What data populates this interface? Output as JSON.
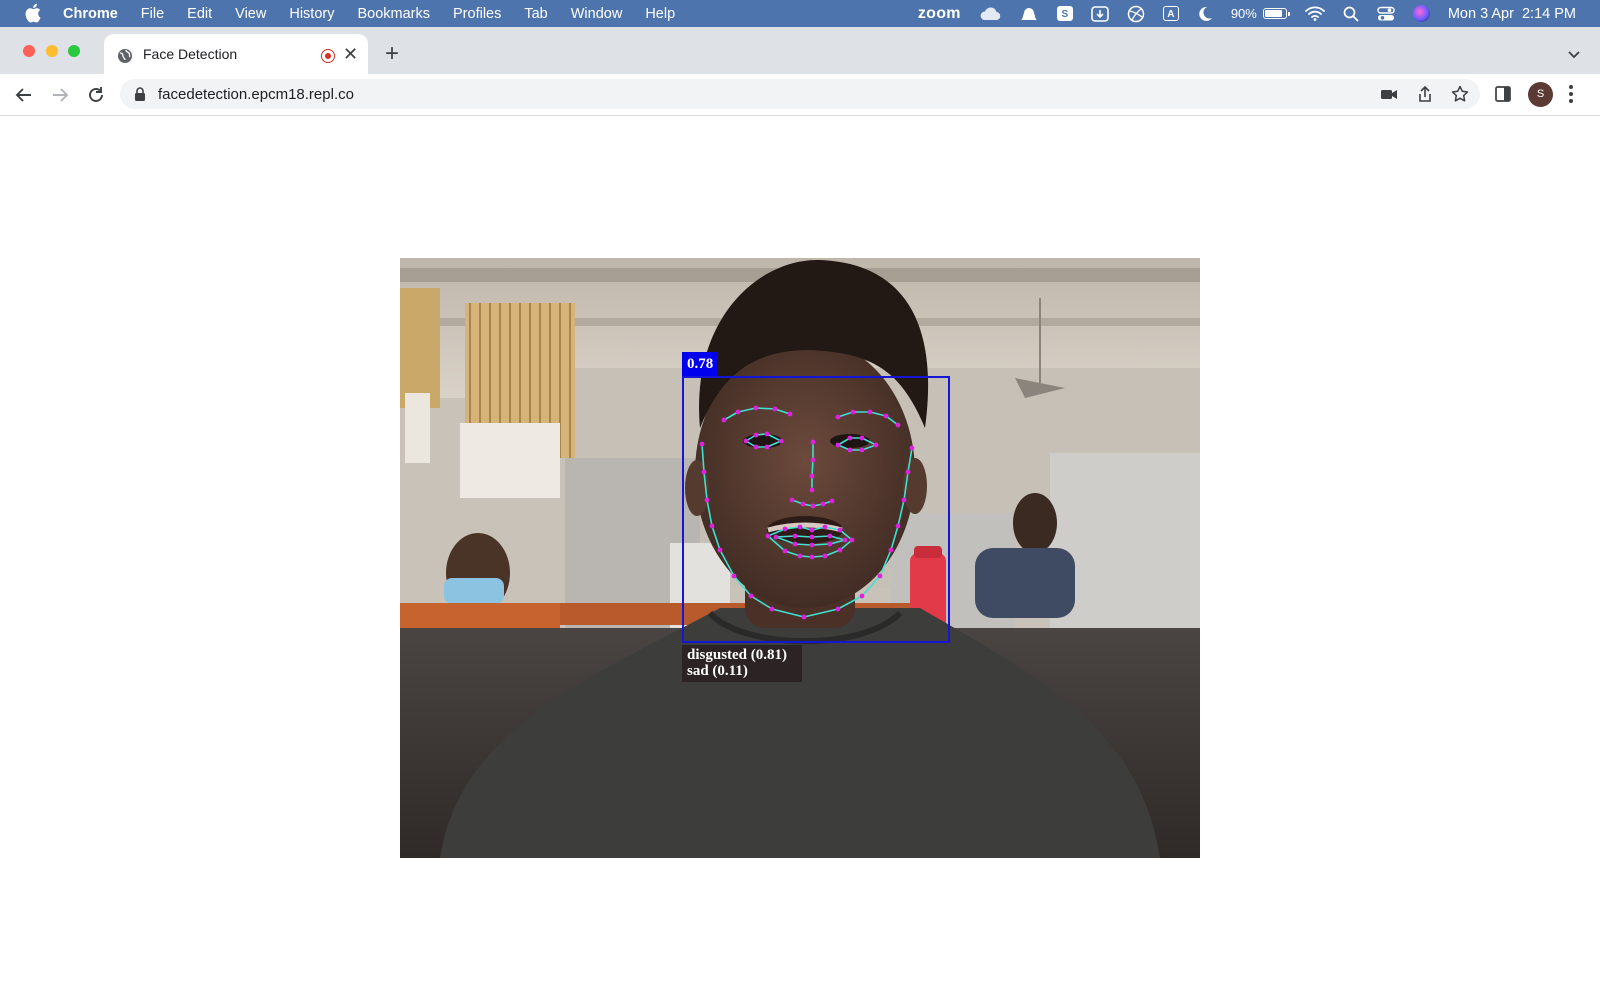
{
  "menubar": {
    "app_name": "Chrome",
    "menus": [
      "File",
      "Edit",
      "View",
      "History",
      "Bookmarks",
      "Profiles",
      "Tab",
      "Window",
      "Help"
    ],
    "status": {
      "zoom_label": "zoom",
      "battery_percent": "90%",
      "battery_level": 0.9,
      "date_time": "Mon 3 Apr  2:14 PM",
      "s_badge": "S",
      "a_badge": "A"
    }
  },
  "browser": {
    "tab_title": "Face Detection",
    "recording": true,
    "url": "facedetection.epcm18.repl.co",
    "avatar_initial": "S"
  },
  "detection": {
    "score": "0.78",
    "expressions": [
      "disgusted (0.81)",
      "sad (0.11)"
    ],
    "box_color": "#1515d8",
    "landmark_line_color": "#3fe0d0",
    "landmark_point_color": "#e020e0"
  }
}
